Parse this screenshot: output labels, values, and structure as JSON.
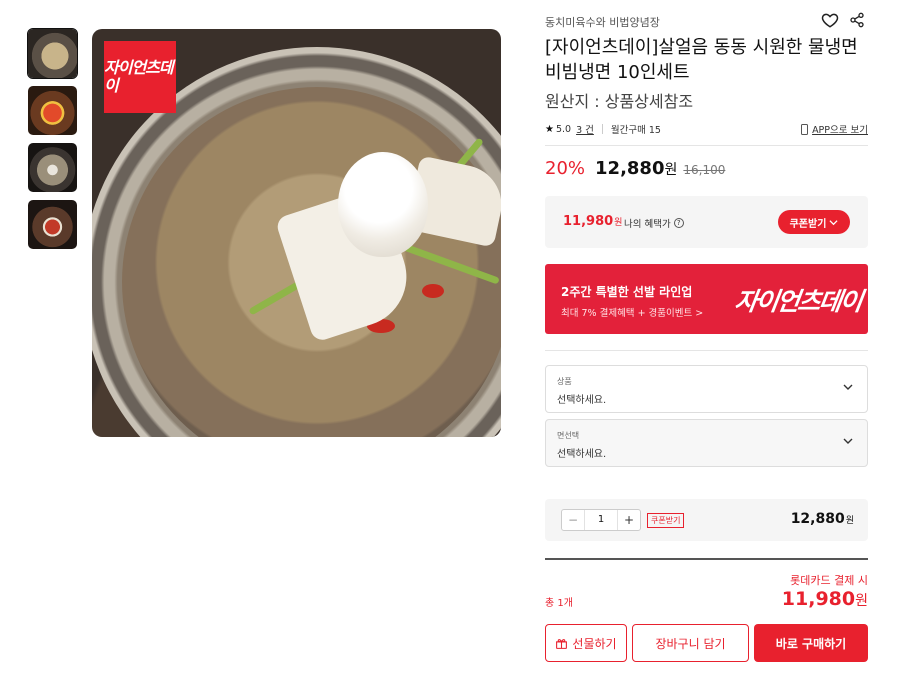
{
  "product": {
    "brand": "동치미육수와 비법양념장",
    "title": "[자이언츠데이]살얼음 동동 시원한 물냉면 비빔냉면 10인세트",
    "origin": "원산지 : 상품상세참조",
    "image_logo": "자이언츠데이"
  },
  "meta": {
    "rating": "5.0",
    "reviews": "3 건",
    "monthly_sales": "월간구매 15",
    "app_link": "APP으로 보기"
  },
  "pricing": {
    "discount": "20%",
    "price": "12,880",
    "won": "원",
    "original": "16,100"
  },
  "benefit": {
    "price": "11,980",
    "unit": "원",
    "label": "나의 혜택가",
    "coupon_button": "쿠폰받기"
  },
  "banner": {
    "title": "2주간 특별한 선발 라인업",
    "subtitle": "최대 7% 결제혜택 + 경품이벤트 >",
    "logo": "자이언츠데이"
  },
  "options": [
    {
      "label": "상품",
      "placeholder": "선택하세요."
    },
    {
      "label": "면선택",
      "placeholder": "선택하세요."
    }
  ],
  "quantity": {
    "minus": "−",
    "value": "1",
    "plus": "+",
    "coupon_tag": "쿠폰받기",
    "price": "12,880",
    "unit": "원"
  },
  "total": {
    "card_note": "롯데카드 결제 시",
    "count_label": "총 1개",
    "price": "11,980",
    "unit": "원"
  },
  "actions": {
    "gift": "선물하기",
    "cart": "장바구니 담기",
    "buy": "바로 구매하기"
  },
  "colors": {
    "accent": "#e8212e"
  },
  "icons": [
    "heart-icon",
    "share-icon",
    "star-icon",
    "phone-icon",
    "help-icon",
    "chevron-down-icon",
    "gift-icon"
  ]
}
